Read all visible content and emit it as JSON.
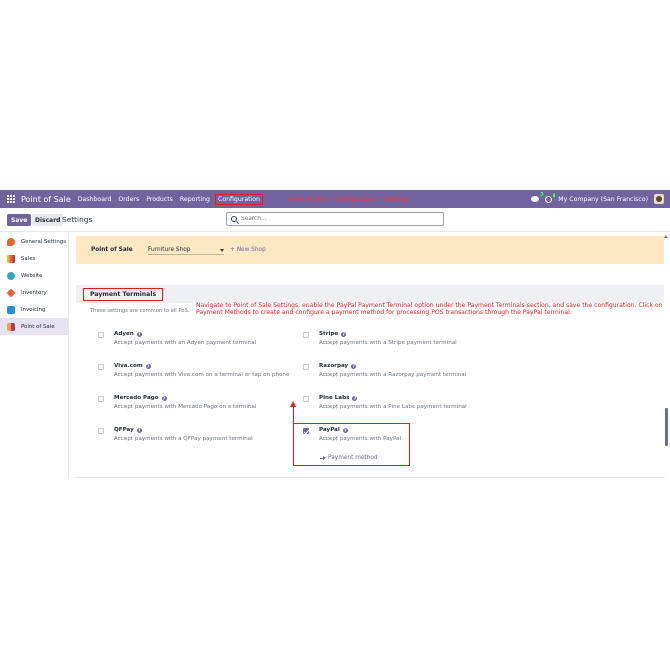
{
  "navbar": {
    "app_name": "Point of Sale",
    "menu": [
      "Dashboard",
      "Orders",
      "Products",
      "Reporting",
      "Configuration"
    ],
    "annotation": "Point of Sale → Configuration → Settings",
    "chat_badge": "7",
    "activity_badge": "4",
    "company": "My Company (San Francisco)",
    "colors": {
      "bar": "#71639e",
      "annotation": "#ff3030"
    }
  },
  "control": {
    "save_label": "Save",
    "discard_label": "Discard",
    "title": "Settings",
    "search_placeholder": "Search..."
  },
  "sidebar": {
    "items": [
      {
        "label": "General Settings",
        "icon": "general-settings-icon"
      },
      {
        "label": "Sales",
        "icon": "sales-icon"
      },
      {
        "label": "Website",
        "icon": "website-icon"
      },
      {
        "label": "Inventory",
        "icon": "inventory-icon"
      },
      {
        "label": "Invoicing",
        "icon": "invoicing-icon"
      },
      {
        "label": "Point of Sale",
        "icon": "point-of-sale-icon",
        "active": true
      }
    ]
  },
  "main": {
    "pos_label": "Point of Sale",
    "shop_value": "Furniture Shop",
    "new_shop_label": "+ New Shop",
    "section_title": "Payment Terminals",
    "section_note": "These settings are common to all PoS.",
    "annotation": "Navigate to Point of Sale Settings, enable the PayPal Payment Terminal option under the Payment Terminals section, and save the configuration. Click on Payment Methods to create and configure a payment method for processing POS transactions through the PayPal terminal.",
    "options": [
      {
        "name": "Adyen",
        "desc": "Accept payments with an Adyen payment terminal",
        "checked": false
      },
      {
        "name": "Stripe",
        "desc": "Accept payments with a Stripe payment terminal",
        "checked": false
      },
      {
        "name": "Viva.com",
        "desc": "Accept payments with Viva.com on a terminal or tap on phone",
        "checked": false
      },
      {
        "name": "Razorpay",
        "desc": "Accept payments with a Razorpay payment terminal",
        "checked": false
      },
      {
        "name": "Mercado Pago",
        "desc": "Accept payments with Mercado Pago on a terminal",
        "checked": false
      },
      {
        "name": "Pine Labs",
        "desc": "Accept payments with a Pine Labs payment terminal",
        "checked": false
      },
      {
        "name": "QFPay",
        "desc": "Accept payments with a QFPay payment terminal",
        "checked": false
      },
      {
        "name": "PayPal",
        "desc": "Accept payments with PayPal",
        "checked": true
      }
    ],
    "payment_method_label": "Payment method",
    "help_glyph": "?"
  }
}
